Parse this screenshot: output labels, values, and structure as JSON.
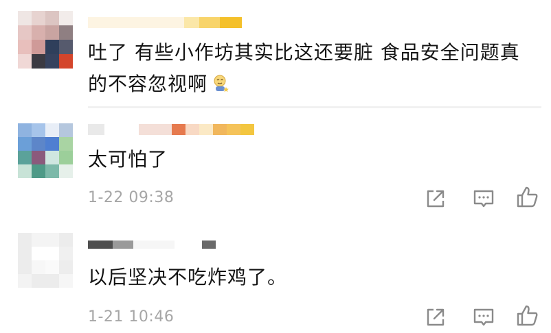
{
  "comments": [
    {
      "text_line1": "吐了 有些小作坊其实比这还要脏 食品安全问题真",
      "text_line2": "的不容忽视啊",
      "emoji": "smiling-figure-emoji"
    },
    {
      "text": "太可怕了",
      "time": "1-22 09:38"
    },
    {
      "text": "以后坚决不吃炸鸡了。",
      "time": "1-21 10:46"
    }
  ],
  "icons": {
    "share": "share-icon",
    "reply": "comment-icon",
    "like": "thumbs-up-icon"
  },
  "colors": {
    "text": "#141414",
    "time": "#a6a6a6",
    "icon": "#8a8a8a",
    "divider": "#f1f1f1"
  }
}
